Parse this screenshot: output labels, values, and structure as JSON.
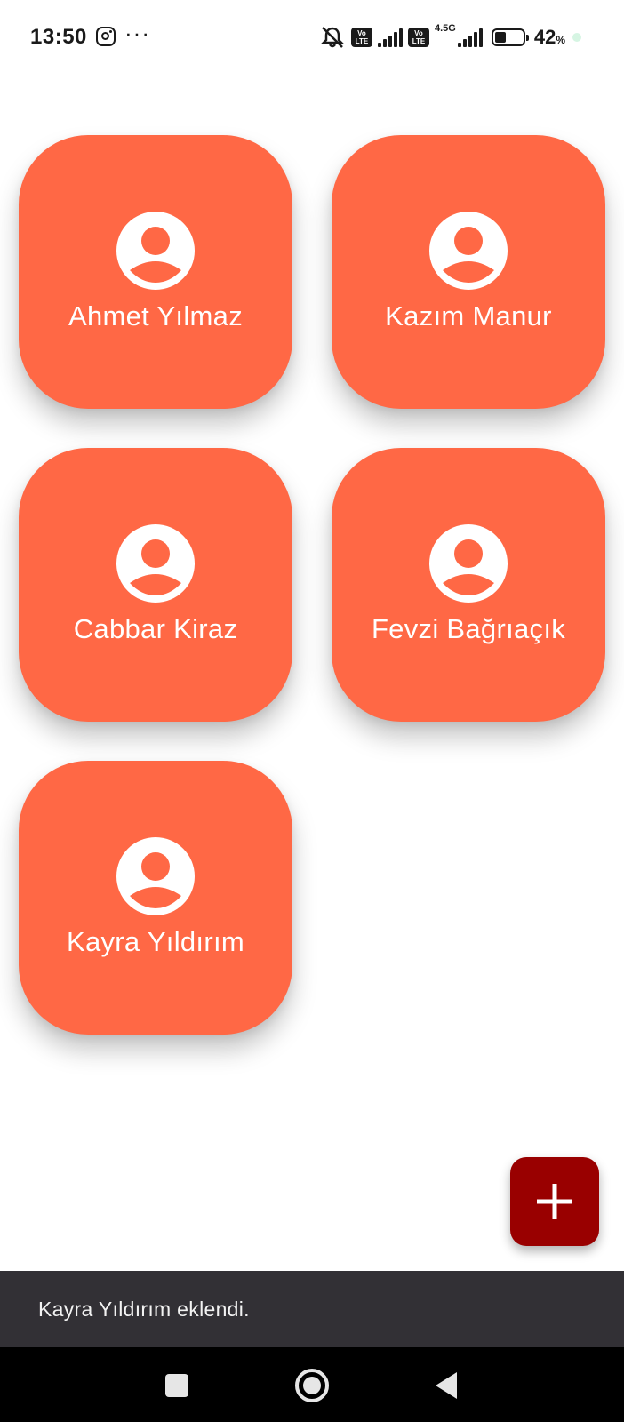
{
  "status_bar": {
    "time": "13:50",
    "network": "4.5G",
    "volte_label": "Vo LTE",
    "battery_percent": "42",
    "battery_unit": "%",
    "battery_level": 0.42,
    "icons": [
      "instagram-icon",
      "more-dots-icon",
      "silent-icon",
      "volte-icon",
      "signal-icon",
      "battery-icon"
    ]
  },
  "contacts": [
    {
      "name": "Ahmet Yılmaz",
      "icon": "account-circle-icon"
    },
    {
      "name": "Kazım Manur",
      "icon": "account-circle-icon"
    },
    {
      "name": "Cabbar Kiraz",
      "icon": "account-circle-icon"
    },
    {
      "name": "Fevzi Bağrıaçık",
      "icon": "account-circle-icon"
    },
    {
      "name": "Kayra Yıldırım",
      "icon": "account-circle-icon"
    }
  ],
  "fab": {
    "icon": "plus-icon"
  },
  "snackbar": {
    "message": "Kayra Yıldırım eklendi."
  },
  "colors": {
    "card": "#ff6845",
    "fab": "#990000",
    "snackbar": "#323035",
    "navbar": "#000000"
  }
}
